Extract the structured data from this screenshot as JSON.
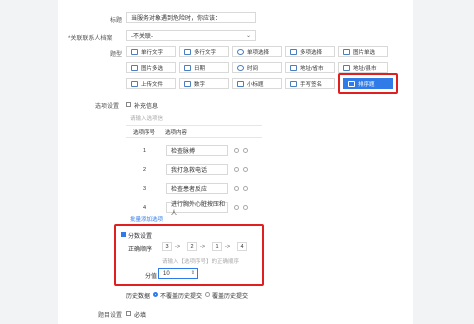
{
  "form": {
    "title_label": "标题",
    "title_value": "当服务对象遇到危险时，你应该：",
    "archive_label": "*关联联系人档案",
    "archive_value": "-不关联-",
    "type_label": "题型"
  },
  "types": [
    {
      "label": "单行文字",
      "icon": "text-icon"
    },
    {
      "label": "多行文字",
      "icon": "paragraph-icon"
    },
    {
      "label": "单项选择",
      "icon": "radio-icon"
    },
    {
      "label": "多项选择",
      "icon": "checkbox-icon"
    },
    {
      "label": "图片单选",
      "icon": "image-icon"
    },
    {
      "label": "图片多选",
      "icon": "image-multi-icon"
    },
    {
      "label": "日期",
      "icon": "calendar-icon"
    },
    {
      "label": "时间",
      "icon": "clock-icon"
    },
    {
      "label": "地址/省市",
      "icon": "location-icon"
    },
    {
      "label": "地址/县市",
      "icon": "location-icon"
    },
    {
      "label": "上传文件",
      "icon": "upload-icon"
    },
    {
      "label": "数字",
      "icon": "number-icon"
    },
    {
      "label": "小标题",
      "icon": "heading-icon"
    },
    {
      "label": "手写签名",
      "icon": "pen-icon"
    },
    {
      "label": "排序题",
      "icon": "sort-icon"
    }
  ],
  "options": {
    "label": "选项设置",
    "supplement_label": "补充信息",
    "placeholder": "请输入选项信",
    "col_order": "选项序号",
    "col_content": "选项内容",
    "rows": [
      {
        "num": "1",
        "text": "检查脉搏"
      },
      {
        "num": "2",
        "text": "我打急救电话"
      },
      {
        "num": "3",
        "text": "检查患者反应"
      },
      {
        "num": "4",
        "text": "进行胸外心脏按压和人"
      }
    ],
    "batch_link": "批量添加选项"
  },
  "score": {
    "label": "分数设置",
    "order_label": "正确顺序",
    "order": [
      "3",
      "2",
      "1",
      "4"
    ],
    "arrow": "->",
    "hint": "请输入【选项序号】的正确顺序",
    "score_label": "分值",
    "score_value": "10"
  },
  "history": {
    "label": "历史数据",
    "opt1": "不覆盖历史提交",
    "opt2": "覆盖历史提交"
  },
  "misc": {
    "label": "题目设置",
    "required": "必填"
  },
  "colors": {
    "accent": "#2f7ce8",
    "highlight": "#e02020"
  }
}
